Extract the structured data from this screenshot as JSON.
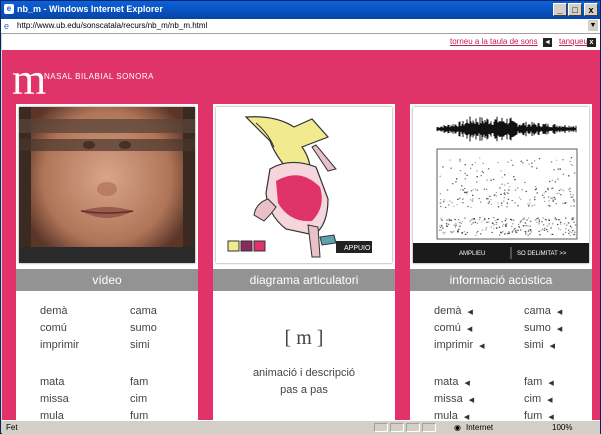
{
  "window": {
    "title": "nb_m - Windows Internet Explorer",
    "minimize": "_",
    "maximize": "□",
    "close": "x"
  },
  "address": {
    "url": "http://www.ub.edu/sonscatala/recurs/nb_m/nb_m.html"
  },
  "nav": {
    "back_link": "torneu a la taula de sons",
    "back_symbol": "◄",
    "close_link": "tanqueu",
    "close_symbol": "x"
  },
  "header": {
    "letter": "m",
    "title": "NASAL BILABIAL SONORA"
  },
  "panels": {
    "video": {
      "label": "vídeo",
      "pairs": [
        [
          "demà",
          "cama"
        ],
        [
          "comú",
          "sumo"
        ],
        [
          "imprimir",
          "simi"
        ],
        [
          "mata",
          "fam"
        ],
        [
          "missa",
          "cim"
        ],
        [
          "mula",
          "fum"
        ]
      ]
    },
    "diagram": {
      "label": "diagrama articulatori",
      "ipa": "[ m ]",
      "anim_line1": "animació i descripció",
      "anim_line2": "pas a pas",
      "brand": "APPUIO"
    },
    "acoustic": {
      "label": "informació acústica",
      "bar_left": "AMPLIEU",
      "bar_right": "SO DELIMITAT >>",
      "pairs": [
        [
          "demà",
          "cama"
        ],
        [
          "comú",
          "sumo"
        ],
        [
          "imprimir",
          "simi"
        ],
        [
          "mata",
          "fam"
        ],
        [
          "missa",
          "cim"
        ],
        [
          "mula",
          "fum"
        ]
      ]
    }
  },
  "status": {
    "left": "Fet",
    "zone": "Internet",
    "zoom": "100%"
  },
  "colors": {
    "accent": "#e0336a",
    "label_bg": "#939393"
  }
}
